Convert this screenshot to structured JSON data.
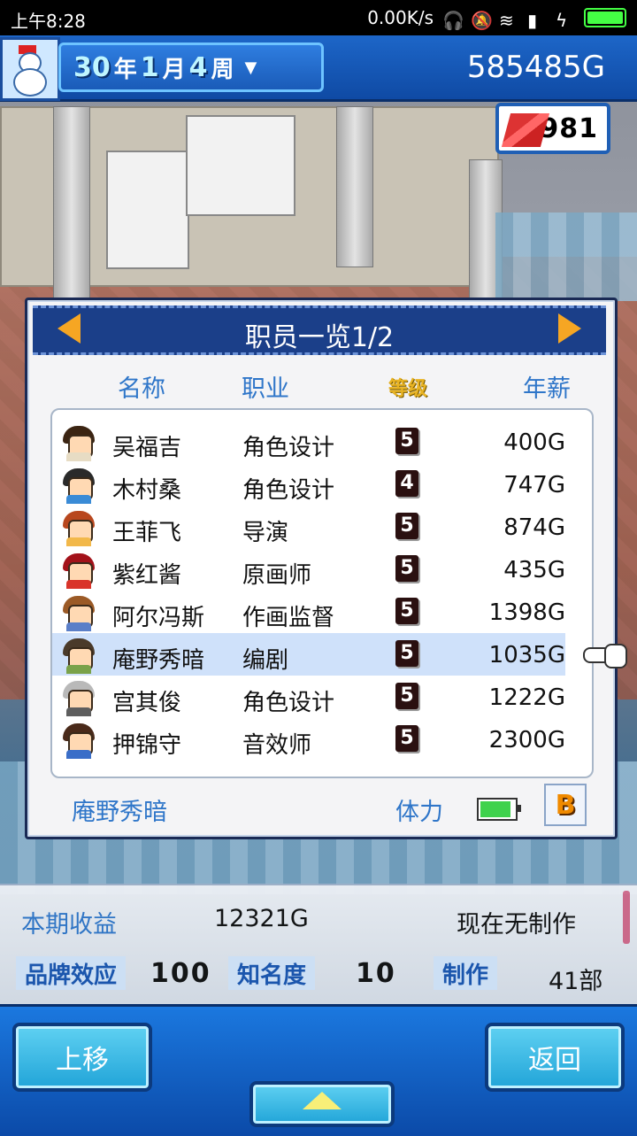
{
  "status_bar": {
    "time": "上午8:28",
    "net": "0.00K/s"
  },
  "hud": {
    "year": "30",
    "year_unit": "年",
    "month": "1",
    "month_unit": "月",
    "week": "4",
    "week_unit": "周",
    "money": "585485G",
    "tickets": "981"
  },
  "panel": {
    "title": "职员一览1/2",
    "columns": {
      "name": "名称",
      "job": "职业",
      "grade": "等级",
      "salary": "年薪"
    },
    "staff": [
      {
        "name": "吴福吉",
        "job": "角色设计",
        "grade": "5",
        "salary": "400G",
        "hair": "#3b2412",
        "shirt": "#e7dcc4",
        "selected": false
      },
      {
        "name": "木村桑",
        "job": "角色设计",
        "grade": "4",
        "salary": "747G",
        "hair": "#2a2a2a",
        "shirt": "#3a8bd6",
        "selected": false
      },
      {
        "name": "王菲飞",
        "job": "导演",
        "grade": "5",
        "salary": "874G",
        "hair": "#b8471e",
        "shirt": "#f2b84a",
        "selected": false
      },
      {
        "name": "紫红酱",
        "job": "原画师",
        "grade": "5",
        "salary": "435G",
        "hair": "#a3121a",
        "shirt": "#d9342a",
        "selected": false
      },
      {
        "name": "阿尔冯斯",
        "job": "作画监督",
        "grade": "5",
        "salary": "1398G",
        "hair": "#9b5a26",
        "shirt": "#5b7fc8",
        "selected": false
      },
      {
        "name": "庵野秀暗",
        "job": "编剧",
        "grade": "5",
        "salary": "1035G",
        "hair": "#4a3a2a",
        "shirt": "#7aa24a",
        "selected": true
      },
      {
        "name": "宫其俊",
        "job": "角色设计",
        "grade": "5",
        "salary": "1222G",
        "hair": "#b9b9b9",
        "shirt": "#5e5e5e",
        "selected": false
      },
      {
        "name": "押锦守",
        "job": "音效师",
        "grade": "5",
        "salary": "2300G",
        "hair": "#4a2a1a",
        "shirt": "#3a6ec8",
        "selected": false
      }
    ],
    "footer": {
      "selected_name": "庵野秀暗",
      "stamina_label": "体力",
      "stamina_level": 0.95,
      "rank": "B"
    }
  },
  "info": {
    "period_income_label": "本期收益",
    "period_income": "12321G",
    "production_status": "现在无制作",
    "brand_label": "品牌效应",
    "brand_value": "100",
    "fame_label": "知名度",
    "fame_value": "10",
    "production_label": "制作",
    "production_count": "41部"
  },
  "buttons": {
    "move_up": "上移",
    "back": "返回"
  },
  "colors": {
    "accent_blue": "#2f76c9",
    "hud_blue": "#1d66c8",
    "grade_gold": "#e8b323"
  }
}
